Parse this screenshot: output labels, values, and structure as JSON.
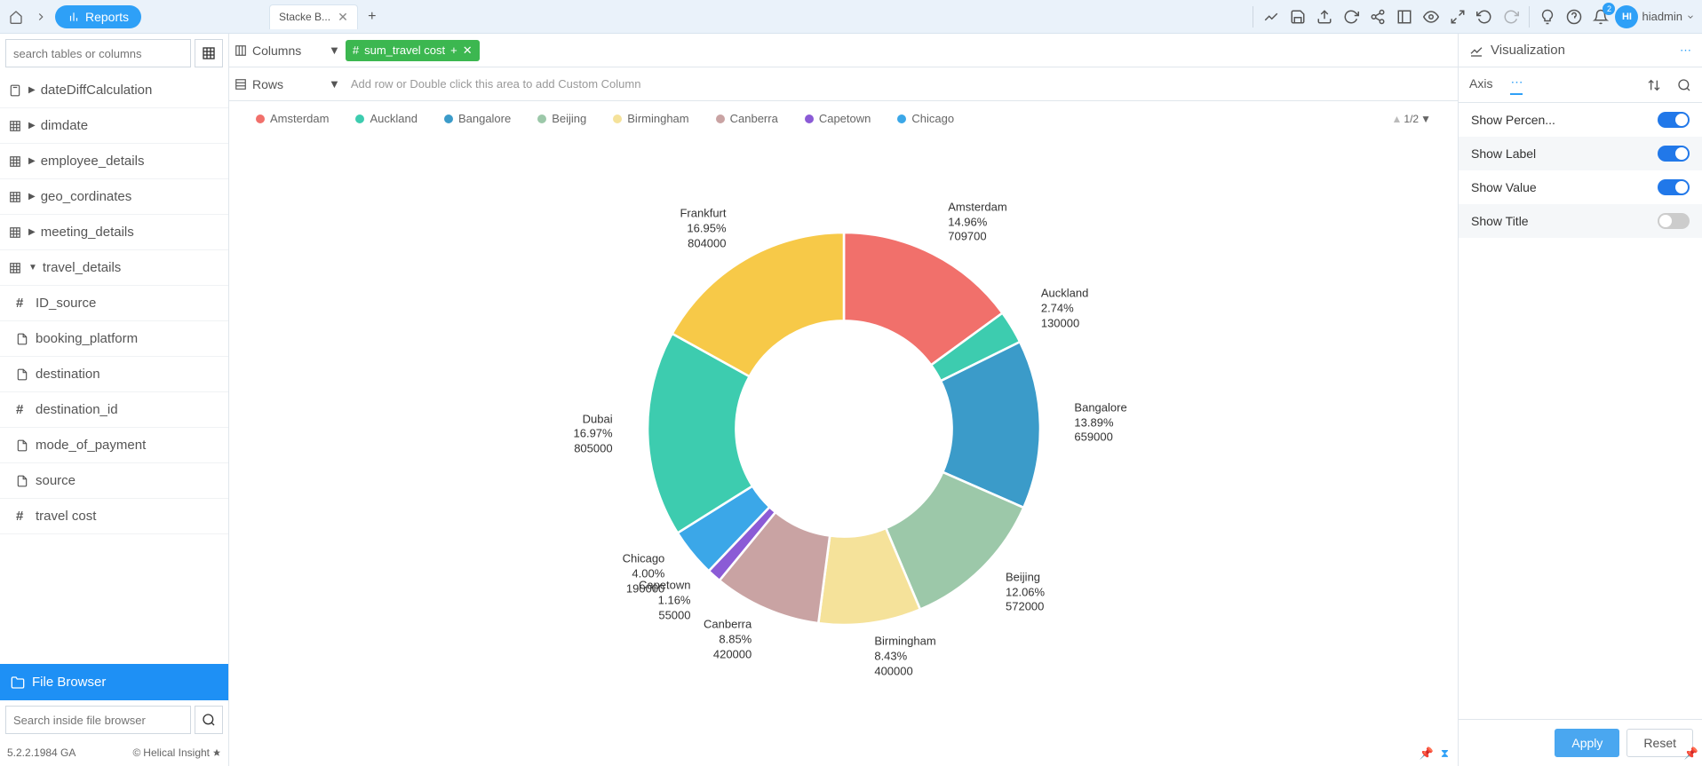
{
  "topbar": {
    "reports_label": "Reports",
    "tab_label": "Stacke B...",
    "notif_badge": "2",
    "user_initials": "HI",
    "user_name": "hiadmin"
  },
  "sidebar": {
    "search_placeholder": "search tables or columns",
    "items": [
      {
        "icon": "calc",
        "label": "dateDiffCalculation",
        "expand": true
      },
      {
        "icon": "table",
        "label": "dimdate",
        "expand": true
      },
      {
        "icon": "table",
        "label": "employee_details",
        "expand": true
      },
      {
        "icon": "table",
        "label": "geo_cordinates",
        "expand": true
      },
      {
        "icon": "table",
        "label": "meeting_details",
        "expand": true
      },
      {
        "icon": "table",
        "label": "travel_details",
        "expand": true,
        "open": true
      }
    ],
    "sub_items": [
      {
        "icon": "hash",
        "label": "ID_source"
      },
      {
        "icon": "doc",
        "label": "booking_platform"
      },
      {
        "icon": "doc",
        "label": "destination"
      },
      {
        "icon": "hash",
        "label": "destination_id"
      },
      {
        "icon": "doc",
        "label": "mode_of_payment"
      },
      {
        "icon": "doc",
        "label": "source"
      },
      {
        "icon": "hash",
        "label": "travel cost"
      }
    ],
    "file_browser_label": "File Browser",
    "fb_search_placeholder": "Search inside file browser",
    "version": "5.2.2.1984 GA",
    "copyright": "Helical Insight"
  },
  "shelves": {
    "columns_label": "Columns",
    "rows_label": "Rows",
    "column_pill": "sum_travel cost",
    "rows_placeholder": "Add row or Double click this area to add Custom Column"
  },
  "legend": {
    "page": "1/2",
    "items": [
      {
        "label": "Amsterdam",
        "color": "#f1706b"
      },
      {
        "label": "Auckland",
        "color": "#3dccaf"
      },
      {
        "label": "Bangalore",
        "color": "#3b9bc9"
      },
      {
        "label": "Beijing",
        "color": "#9cc8a9"
      },
      {
        "label": "Birmingham",
        "color": "#f5e29a"
      },
      {
        "label": "Canberra",
        "color": "#c9a3a3"
      },
      {
        "label": "Capetown",
        "color": "#8b5bd6"
      },
      {
        "label": "Chicago",
        "color": "#3ba7e8"
      }
    ]
  },
  "chart_data": {
    "type": "pie",
    "title": "",
    "series_name": "sum_travel cost",
    "slices": [
      {
        "label": "Amsterdam",
        "percent": 14.96,
        "value": 709700,
        "color": "#f1706b"
      },
      {
        "label": "Auckland",
        "percent": 2.74,
        "value": 130000,
        "color": "#3dccaf"
      },
      {
        "label": "Bangalore",
        "percent": 13.89,
        "value": 659000,
        "color": "#3b9bc9"
      },
      {
        "label": "Beijing",
        "percent": 12.06,
        "value": 572000,
        "color": "#9cc8a9"
      },
      {
        "label": "Birmingham",
        "percent": 8.43,
        "value": 400000,
        "color": "#f5e29a"
      },
      {
        "label": "Canberra",
        "percent": 8.85,
        "value": 420000,
        "color": "#c9a3a3"
      },
      {
        "label": "Capetown",
        "percent": 1.16,
        "value": 55000,
        "color": "#8b5bd6"
      },
      {
        "label": "Chicago",
        "percent": 4.0,
        "value": 190000,
        "color": "#3ba7e8"
      },
      {
        "label": "Dubai",
        "percent": 16.97,
        "value": 805000,
        "color": "#3dccaf"
      },
      {
        "label": "Frankfurt",
        "percent": 16.95,
        "value": 804000,
        "color": "#f7c948"
      }
    ],
    "donut": true,
    "inner_radius_ratio": 0.55
  },
  "vizPanel": {
    "header": "Visualization",
    "tab_axis": "Axis",
    "props": [
      {
        "label": "Show Percen...",
        "on": true
      },
      {
        "label": "Show Label",
        "on": true
      },
      {
        "label": "Show Value",
        "on": true
      },
      {
        "label": "Show Title",
        "on": false
      }
    ],
    "apply": "Apply",
    "reset": "Reset"
  }
}
